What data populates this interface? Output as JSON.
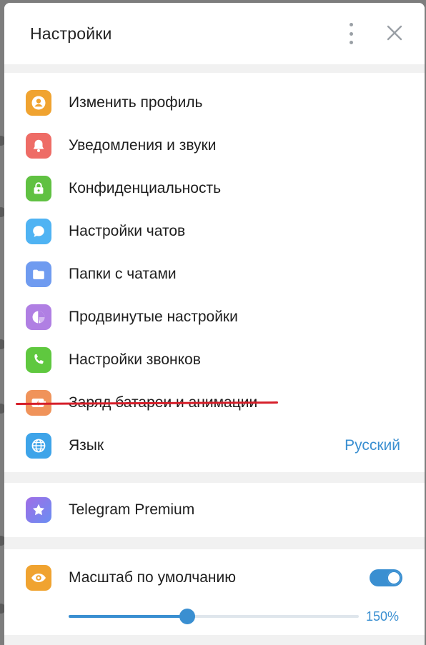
{
  "window": {
    "title": "Настройки"
  },
  "colors": {
    "accent": "#3a8fd1",
    "underline": "#d61f2a"
  },
  "menu": [
    {
      "label": "Изменить профиль",
      "icon": "person-icon",
      "color": "#f0a330"
    },
    {
      "label": "Уведомления и звуки",
      "icon": "bell-icon",
      "color": "#ee6c66"
    },
    {
      "label": "Конфиденциальность",
      "icon": "lock-icon",
      "color": "#60c142"
    },
    {
      "label": "Настройки чатов",
      "icon": "chat-bubble-icon",
      "color": "#4fb3f3"
    },
    {
      "label": "Папки с чатами",
      "icon": "folder-icon",
      "color": "#6f9bf0"
    },
    {
      "label": "Продвинутые настройки",
      "icon": "pie-chart-icon",
      "color": "#b07fe3"
    },
    {
      "label": "Настройки звонков",
      "icon": "phone-icon",
      "color": "#5fc83f"
    },
    {
      "label": "Заряд батареи и анимации",
      "icon": "battery-icon",
      "color": "#f0935a"
    },
    {
      "label": "Язык",
      "icon": "globe-icon",
      "color": "#3ea4e9",
      "value": "Русский"
    }
  ],
  "premium": {
    "label": "Telegram Premium",
    "icon": "star-icon"
  },
  "scale": {
    "label": "Масштаб по умолчанию",
    "icon": "eye-icon",
    "toggle_on": true,
    "value_label": "150%",
    "slider_fraction": 0.41
  }
}
